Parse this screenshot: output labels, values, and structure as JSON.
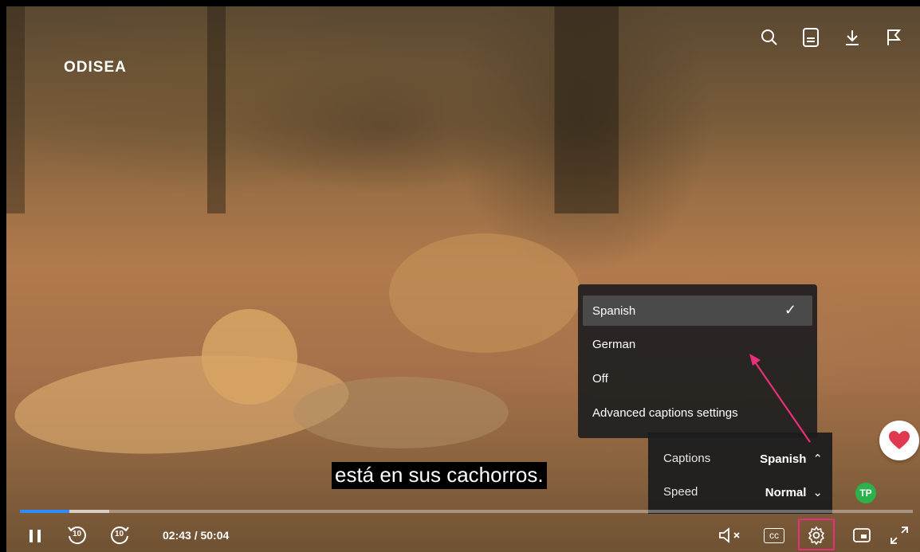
{
  "player": {
    "logo": "ODISEA",
    "subtitle": "está en sus cachorros.",
    "time_display": "02:43 / 50:04",
    "progress_played_fraction": 0.055,
    "progress_loaded_fraction": 0.1
  },
  "top_icons": [
    "search-icon",
    "transcript-icon",
    "download-icon",
    "flag-icon"
  ],
  "captions_menu": {
    "items": [
      {
        "label": "Spanish",
        "selected": true
      },
      {
        "label": "German",
        "selected": false
      },
      {
        "label": "Off",
        "selected": false
      },
      {
        "label": "Advanced captions settings",
        "selected": false
      }
    ],
    "check": "✓"
  },
  "settings_panel": {
    "captions_label": "Captions",
    "captions_value": "Spanish",
    "speed_label": "Speed",
    "speed_value": "Normal"
  },
  "controls": {
    "rewind_label": "10",
    "forward_label": "10",
    "cc_label": "cc"
  },
  "avatar_initials": "TP",
  "colors": {
    "accent_progress": "#2f8cff",
    "highlight": "#e8307a",
    "heart": "#e0384f",
    "avatar": "#2bb24c"
  }
}
